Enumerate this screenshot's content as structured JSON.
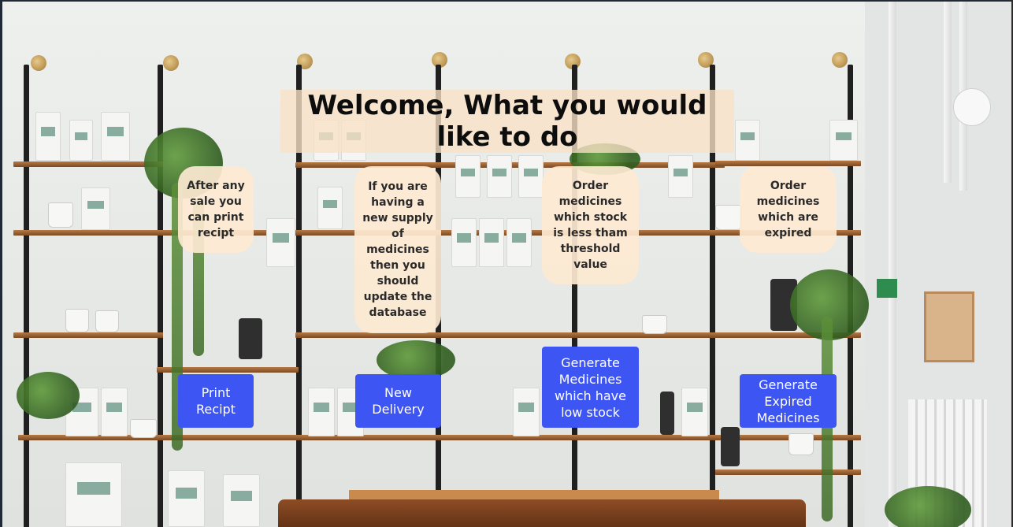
{
  "header": {
    "title": "Welcome, What you would like to do"
  },
  "cards": [
    {
      "description": "After any sale you can print recipt",
      "button_label": "Print Recipt"
    },
    {
      "description": "If you are having a new supply of medicines then you should update the database",
      "button_label": "New Delivery"
    },
    {
      "description": "Order medicines which stock is less tham threshold value",
      "button_label": "Generate Medicines which have low stock"
    },
    {
      "description": "Order medicines which are expired",
      "button_label": "Generate Expired Medicines"
    }
  ],
  "colors": {
    "button_bg": "#3d55f2",
    "button_text": "#ffffff",
    "card_bg": "#fde9d1",
    "title_bg": "#f8e2c5"
  }
}
